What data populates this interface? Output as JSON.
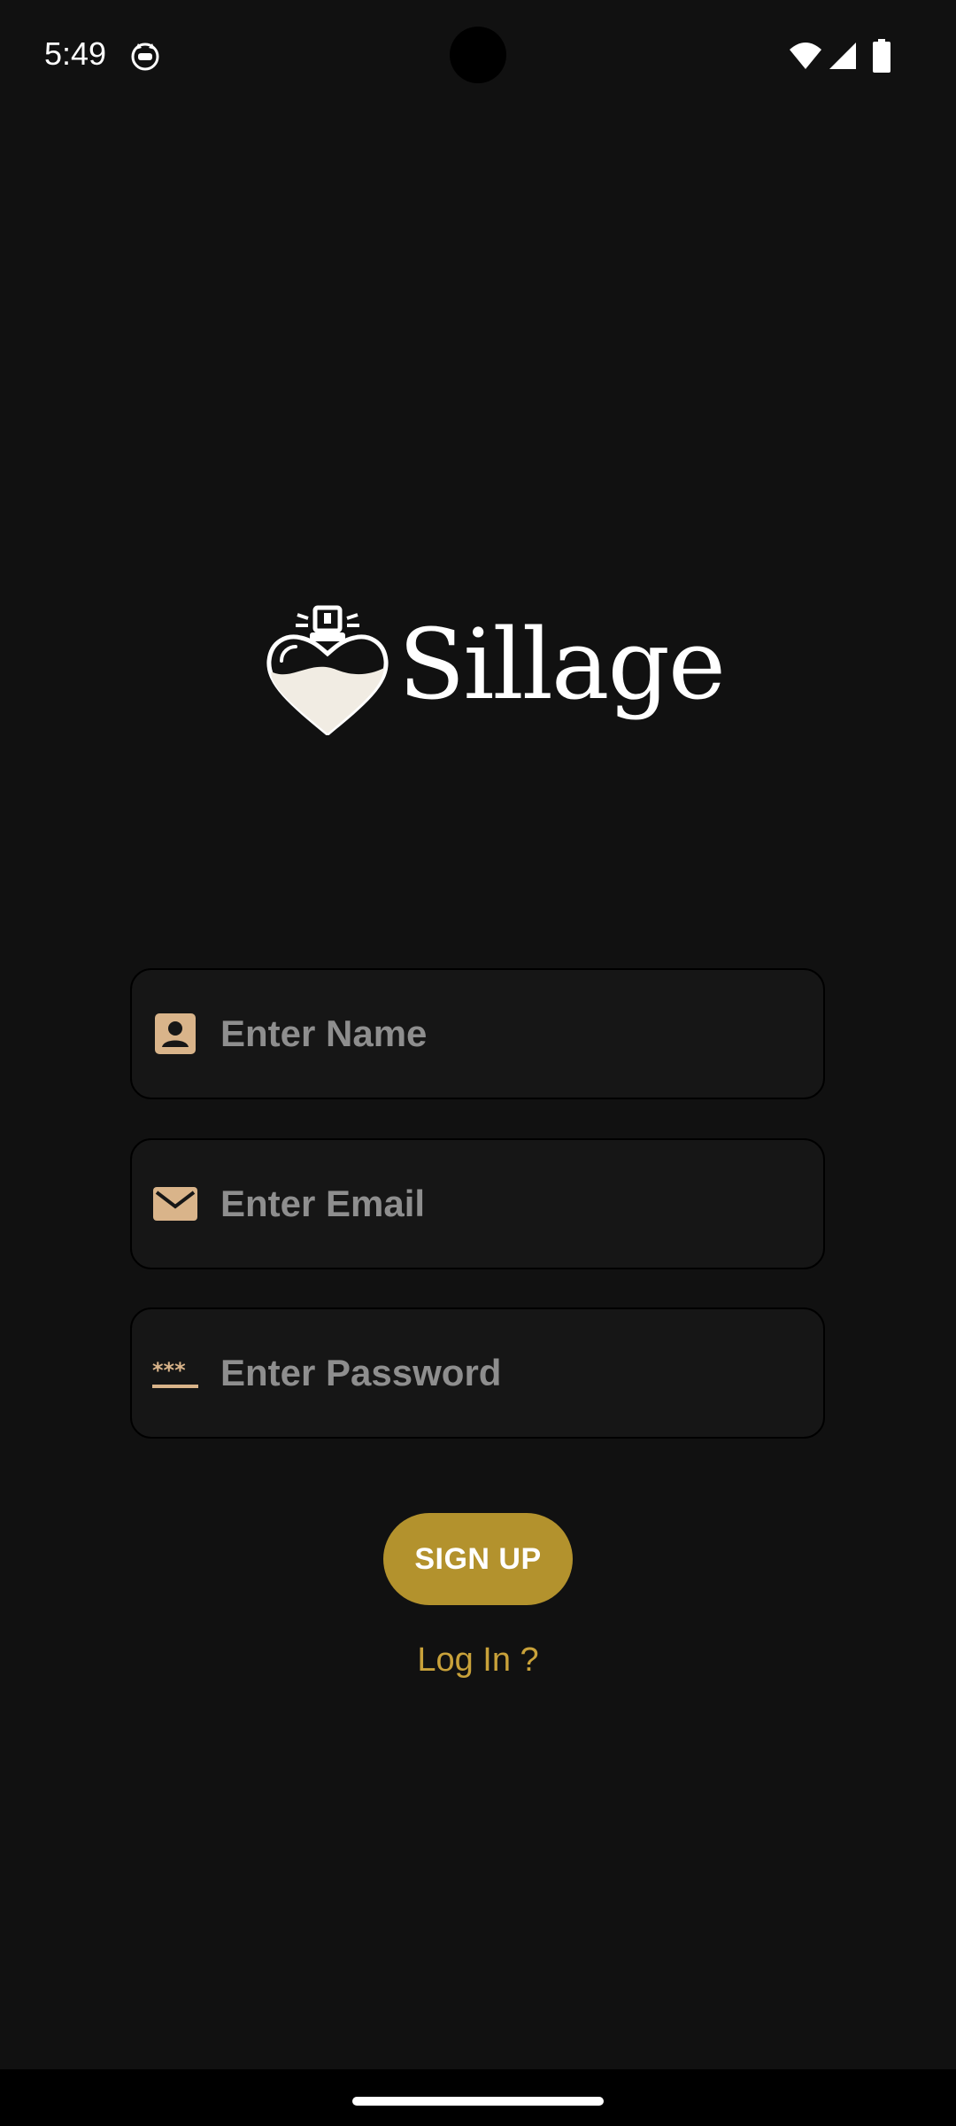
{
  "status_bar": {
    "time": "5:49",
    "app_icon": "cat-face-icon",
    "wifi_icon": "wifi-icon",
    "signal_icon": "cell-signal-icon",
    "battery_icon": "battery-icon"
  },
  "logo": {
    "text": "Sillage",
    "icon": "heart-perfume-bottle-icon"
  },
  "form": {
    "name": {
      "placeholder": "Enter Name",
      "value": "",
      "icon": "contact-card-icon"
    },
    "email": {
      "placeholder": "Enter Email",
      "value": "",
      "icon": "mail-icon"
    },
    "password": {
      "placeholder": "Enter Password",
      "value": "",
      "icon": "password-dots-icon"
    }
  },
  "actions": {
    "signup_label": "SIGN UP",
    "login_label": "Log In ?"
  },
  "colors": {
    "background": "#111111",
    "field_background": "#161616",
    "accent": "#B3922D",
    "link": "#C9A23A",
    "icon_tint": "#D9B48A"
  }
}
